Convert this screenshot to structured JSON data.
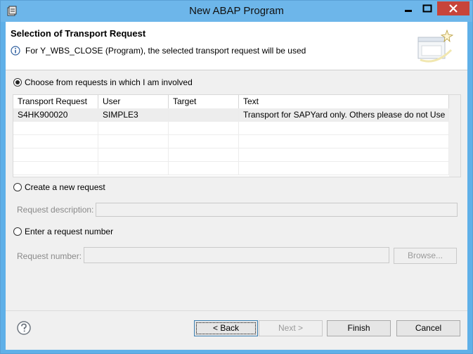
{
  "window": {
    "title": "New ABAP Program",
    "controls": [
      "minimize-icon",
      "maximize-icon",
      "close-icon"
    ]
  },
  "header": {
    "title": "Selection of Transport Request",
    "message": "For Y_WBS_CLOSE (Program), the selected transport request will be used"
  },
  "options": {
    "choose": {
      "label": "Choose from requests in which I am involved",
      "checked": true
    },
    "create": {
      "label": "Create a new request",
      "checked": false
    },
    "enter": {
      "label": "Enter a request number",
      "checked": false
    }
  },
  "table": {
    "columns": [
      "Transport Request",
      "User",
      "Target",
      "Text"
    ],
    "rows": [
      {
        "request": "S4HK900020",
        "user": "SIMPLE3",
        "target": "",
        "text": "Transport for SAPYard only. Others please do not Use"
      }
    ]
  },
  "fields": {
    "request_description": {
      "label": "Request description:",
      "value": ""
    },
    "request_number": {
      "label": "Request number:",
      "value": ""
    },
    "browse_label": "Browse..."
  },
  "buttons": {
    "back": "< Back",
    "next": "Next >",
    "finish": "Finish",
    "cancel": "Cancel"
  },
  "colors": {
    "titlebar": "#6db6ea",
    "close_button": "#c7443a",
    "default_button_border": "#3c7fb1"
  }
}
